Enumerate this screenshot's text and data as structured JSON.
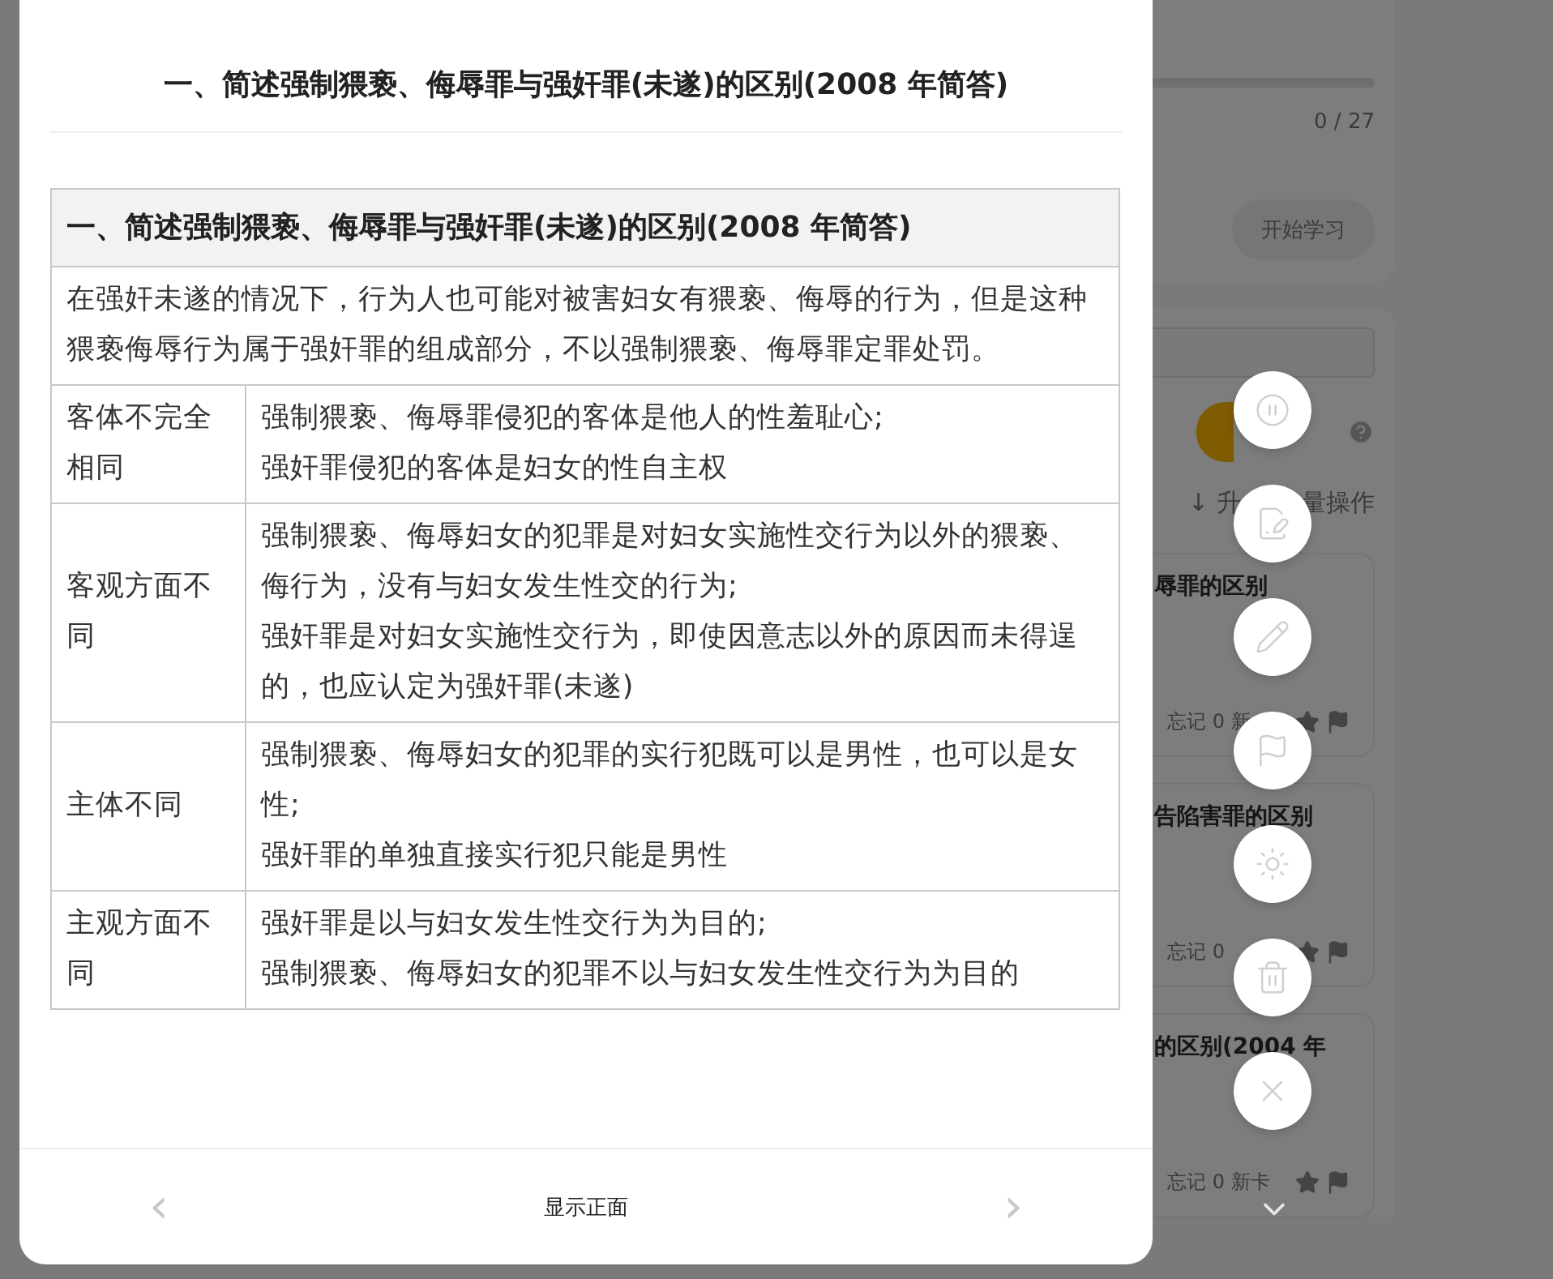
{
  "background": {
    "progress_card": {
      "count": "0 / 27",
      "start_button": "开始学习"
    },
    "list_controls": {
      "sort": "↓ 升",
      "batch": "量操作"
    },
    "cards": [
      {
        "title": "辱罪的区别",
        "stats": "忘记 0 新"
      },
      {
        "title": "告陷害罪的区别",
        "stats": "忘记 0"
      },
      {
        "title": "的区别(2004 年",
        "stats": "忘记 0 新卡"
      }
    ]
  },
  "dialog": {
    "title": "一、简述强制猥亵、侮辱罪与强奸罪(未遂)的区别(2008 年简答)",
    "table": {
      "header": "一、简述强制猥亵、侮辱罪与强奸罪(未遂)的区别(2008 年简答)",
      "intro": "在强奸未遂的情况下，行为人也可能对被害妇女有猥亵、侮辱的行为，但是这种猥亵侮辱行为属于强奸罪的组成部分，不以强制猥亵、侮辱罪定罪处罚。",
      "rows": [
        {
          "label": "客体不完全相同",
          "lines": [
            "强制猥亵、侮辱罪侵犯的客体是他人的性羞耻心;",
            "强奸罪侵犯的客体是妇女的性自主权"
          ]
        },
        {
          "label": "客观方面不同",
          "lines": [
            "强制猥亵、侮辱妇女的犯罪是对妇女实施性交行为以外的猥亵、侮行为，没有与妇女发生性交的行为;",
            "强奸罪是对妇女实施性交行为，即使因意志以外的原因而未得逞的，也应认定为强奸罪(未遂)"
          ]
        },
        {
          "label": "主体不同",
          "lines": [
            "强制猥亵、侮辱妇女的犯罪的实行犯既可以是男性，也可以是女性;",
            "强奸罪的单独直接实行犯只能是男性"
          ]
        },
        {
          "label": "主观方面不同",
          "lines": [
            "强奸罪是以与妇女发生性交行为为目的;",
            "强制猥亵、侮辱妇女的犯罪不以与妇女发生性交行为为目的"
          ]
        }
      ]
    },
    "footer": {
      "prev": "‹",
      "flip": "显示正面",
      "next": "›"
    }
  },
  "actions": [
    {
      "kind": "pause"
    },
    {
      "kind": "edit"
    },
    {
      "kind": "pencil"
    },
    {
      "kind": "flag"
    },
    {
      "kind": "brightness"
    },
    {
      "kind": "delete"
    },
    {
      "kind": "close"
    }
  ]
}
